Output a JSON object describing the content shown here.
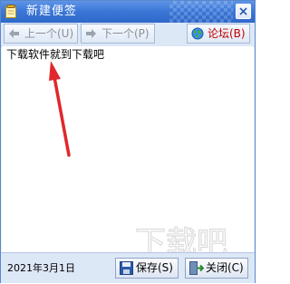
{
  "window": {
    "title": "新建便签"
  },
  "toolbar": {
    "prev_label": "上一个(U)",
    "next_label": "下一个(P)",
    "forum_label": "论坛(B)"
  },
  "note": {
    "content": "下载软件就到下载吧"
  },
  "status": {
    "date": "2021年3月1日",
    "save_label": "保存(S)",
    "close_label": "关闭(C)"
  },
  "watermark": {
    "text": "下载吧"
  },
  "icons": {
    "title": "note-icon",
    "prev": "arrow-left-icon",
    "next": "arrow-right-icon",
    "forum": "globe-icon",
    "save": "floppy-disk-icon",
    "close": "exit-door-icon"
  },
  "colors": {
    "title_bar": "#3c78d8",
    "forum_text": "#c00000",
    "arrow": "#e0272b"
  }
}
